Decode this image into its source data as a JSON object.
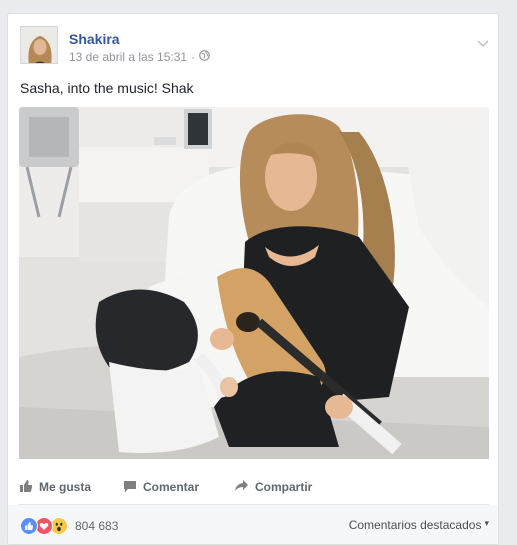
{
  "post": {
    "page_name": "Shakira",
    "timestamp": "13 de abril a las 15:31",
    "separator": "·",
    "audience_icon": "globe-icon",
    "text": "Sasha, into the music! Shak"
  },
  "actions": {
    "like_label": "Me gusta",
    "comment_label": "Comentar",
    "share_label": "Compartir"
  },
  "footer": {
    "reaction_count": "804 683",
    "reaction_icons": [
      "like-reaction-icon",
      "love-reaction-icon",
      "wow-reaction-icon"
    ],
    "top_comments_label": "Comentarios destacados",
    "top_comments_caret": "▾"
  },
  "colors": {
    "page_name": "#365899",
    "meta": "#90949c",
    "like_blue": "#5890ff",
    "love_red": "#f25268",
    "wow_yellow": "#f7c94b"
  }
}
